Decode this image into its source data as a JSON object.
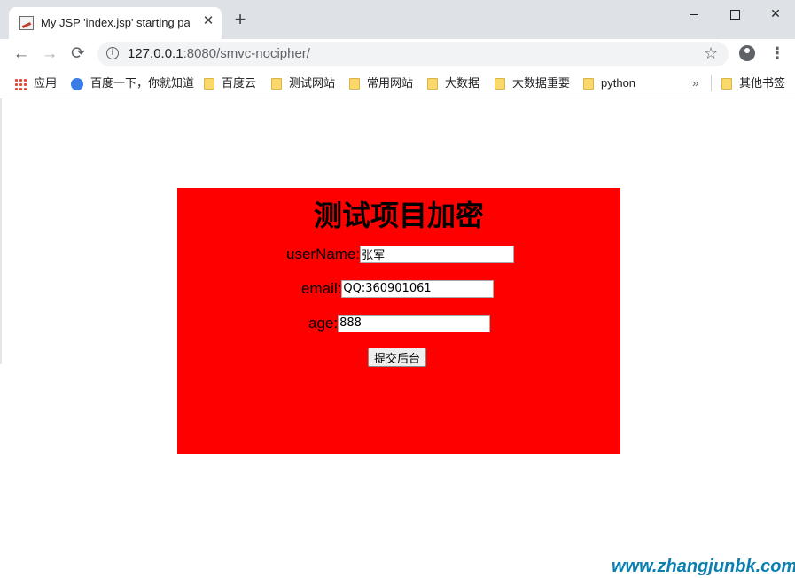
{
  "browser": {
    "tab_title": "My JSP 'index.jsp' starting pag",
    "tab_close": "✕",
    "new_tab": "+",
    "url_host": "127.0.0.1",
    "url_rest": ":8080/smvc-nocipher/",
    "bookmarks": [
      {
        "label": "应用",
        "icon": "apps-icon"
      },
      {
        "label": "百度一下，你就知道",
        "icon": "baidu-icon"
      },
      {
        "label": "百度云",
        "icon": "folder-icon"
      },
      {
        "label": "测试网站",
        "icon": "folder-icon"
      },
      {
        "label": "常用网站",
        "icon": "folder-icon"
      },
      {
        "label": "大数据",
        "icon": "folder-icon"
      },
      {
        "label": "大数据重要",
        "icon": "folder-icon"
      },
      {
        "label": "python",
        "icon": "folder-icon"
      },
      {
        "label": "其他书签",
        "icon": "folder-icon"
      }
    ],
    "overflow": "»"
  },
  "page": {
    "title": "测试项目加密",
    "background": "#ff0000",
    "form": {
      "username_label": "userName:",
      "username_value": "张军",
      "email_label": "email:",
      "email_value": "QQ:360901061",
      "age_label": "age:",
      "age_value": "888",
      "submit_label": "提交后台"
    }
  },
  "watermark": "www.zhangjunbk.com"
}
